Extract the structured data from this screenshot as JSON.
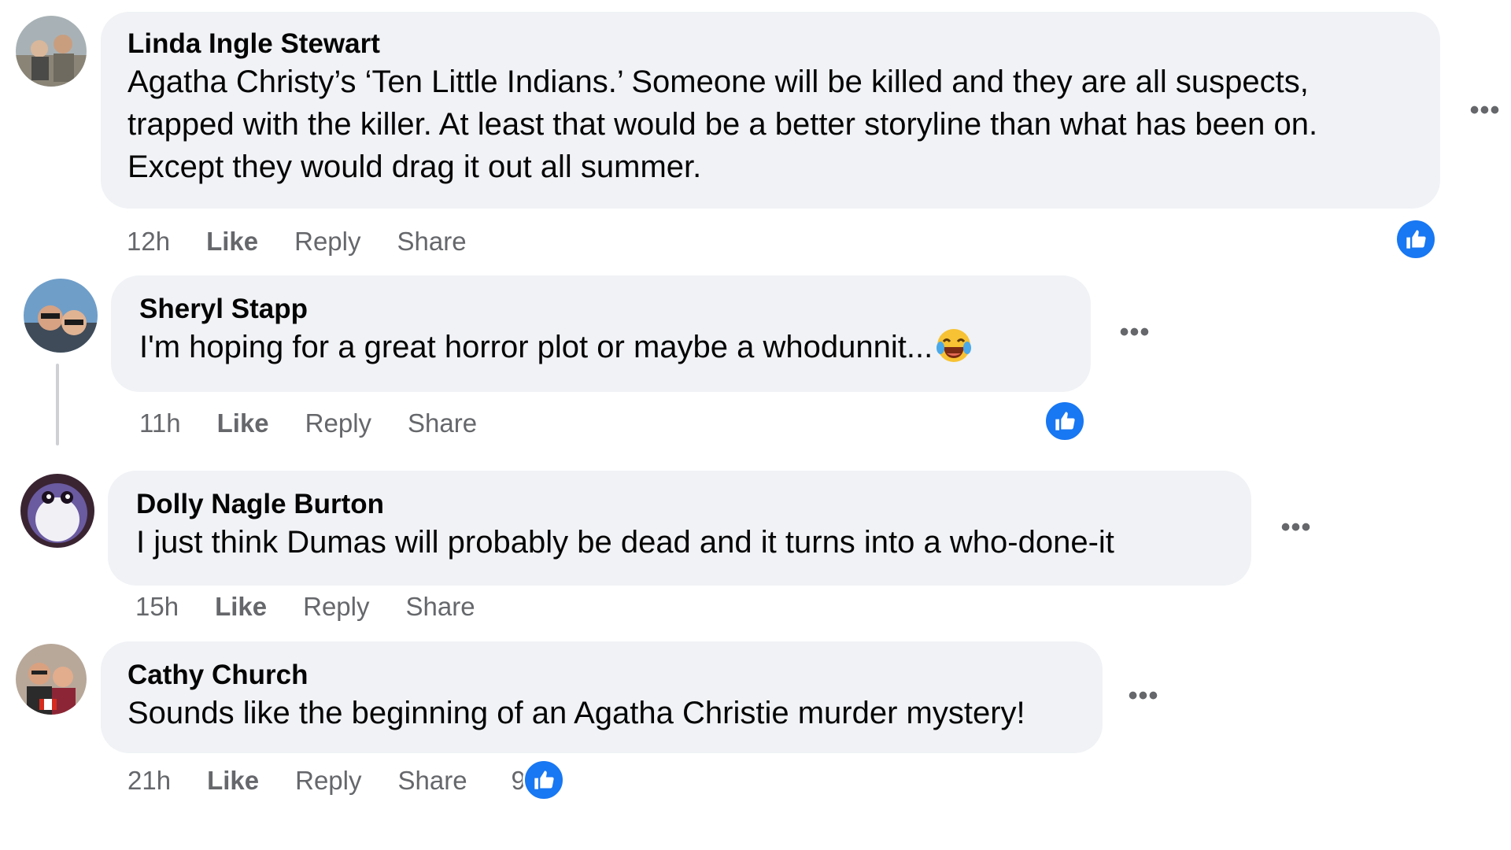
{
  "comments": [
    {
      "author": "Linda Ingle Stewart",
      "text": "Agatha Christy’s ‘Ten Little Indians.’ Someone will be killed and they are all suspects, trapped with the killer. At least that would be a better storyline than what has been on. Except they would drag it out all summer.",
      "time": "12h",
      "like": "Like",
      "reply": "Reply",
      "share": "Share",
      "more_icon": "more-options-icon",
      "reaction_icon": "like-reaction-icon"
    },
    {
      "author": "Sheryl Stapp",
      "text": "I'm hoping for a great horror plot or maybe a whodunnit...",
      "emoji": "laughing-tears-emoji",
      "time": "11h",
      "like": "Like",
      "reply": "Reply",
      "share": "Share",
      "more_icon": "more-options-icon",
      "reaction_icon": "like-reaction-icon"
    },
    {
      "author": "Dolly Nagle Burton",
      "text": "I just think Dumas will probably be dead and it turns into a who-done-it",
      "time": "15h",
      "like": "Like",
      "reply": "Reply",
      "share": "Share",
      "more_icon": "more-options-icon"
    },
    {
      "author": "Cathy Church",
      "text": "Sounds like the beginning of an Agatha Christie murder mystery!",
      "time": "21h",
      "like": "Like",
      "reply": "Reply",
      "share": "Share",
      "reaction_count": "9",
      "more_icon": "more-options-icon",
      "reaction_icon": "like-reaction-icon"
    }
  ],
  "colors": {
    "bubble": "#f0f2f5",
    "secondary_text": "#65676b",
    "like_blue": "#1877f2"
  }
}
